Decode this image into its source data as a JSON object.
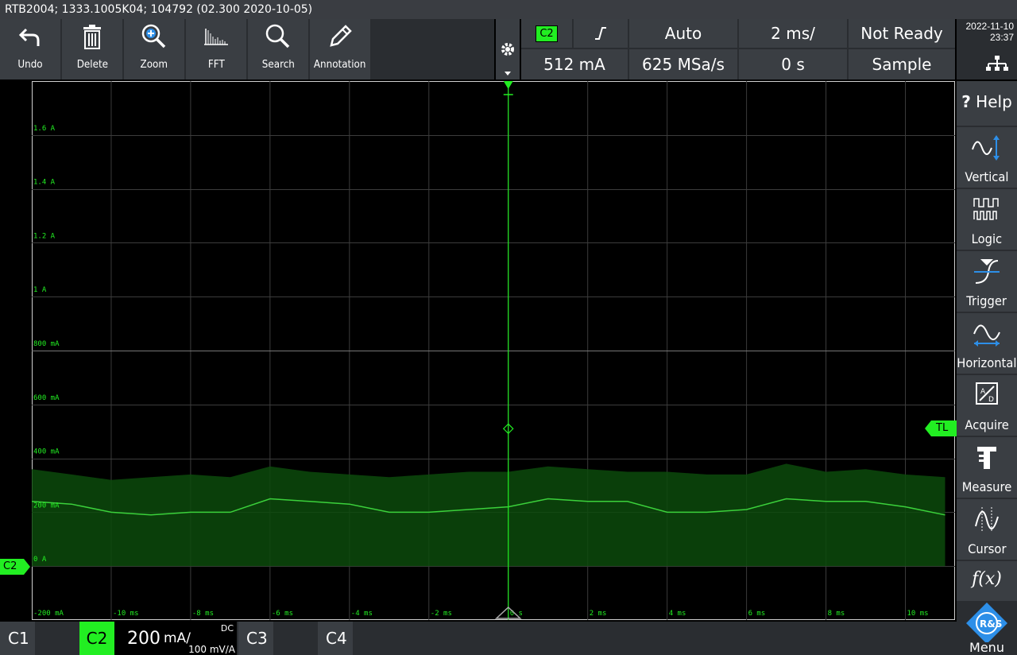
{
  "title": "RTB2004; 1333.1005K04; 104792 (02.300 2020-10-05)",
  "toolbar": {
    "items": [
      {
        "label": "Undo",
        "icon": "undo-icon"
      },
      {
        "label": "Delete",
        "icon": "trash-icon"
      },
      {
        "label": "Zoom",
        "icon": "zoom-icon"
      },
      {
        "label": "FFT",
        "icon": "fft-icon"
      },
      {
        "label": "Search",
        "icon": "search-icon"
      },
      {
        "label": "Annotation",
        "icon": "pencil-icon"
      }
    ]
  },
  "info": {
    "channel_badge": "C2",
    "trigger_level": "512 mA",
    "mode": "Auto",
    "sample_rate": "625 MSa/s",
    "timebase": "2 ms/",
    "time_offset": "0 s",
    "status": "Not Ready",
    "acquisition": "Sample"
  },
  "clock": {
    "date": "2022-11-10",
    "time": "23:37"
  },
  "sidebar": {
    "help": "Help",
    "items": [
      "Vertical",
      "Logic",
      "Trigger",
      "Horizontal",
      "Acquire",
      "Measure",
      "Cursor"
    ],
    "func_label": "f(x)",
    "menu": "Menu",
    "logo_text": "R&S"
  },
  "markers": {
    "channel": "C2",
    "trigger_level_tag": "TL"
  },
  "channels": {
    "c1": "C1",
    "c2": "C2",
    "c2_scale": "200",
    "c2_unit": "mA/",
    "c2_coupling": "DC",
    "c2_probe": "100 mV/A",
    "c3": "C3",
    "c4": "C4"
  },
  "colors": {
    "accent_green": "#22ee22",
    "trace_green": "#3bd13b",
    "panel": "#3a3e43",
    "bg": "#2a2d31"
  },
  "chart_data": {
    "type": "line",
    "xlabel": "",
    "ylabel": "",
    "y_tick_labels": [
      "1.6 A",
      "1.4 A",
      "1.2 A",
      "1 A",
      "800 mA",
      "600 mA",
      "400 mA",
      "200 mA",
      "0 A",
      "-200 mA"
    ],
    "x_tick_labels": [
      "-10 ms",
      "-8 ms",
      "-6 ms",
      "-4 ms",
      "-2 ms",
      "0 s",
      "2 ms",
      "4 ms",
      "6 ms",
      "8 ms",
      "10 ms"
    ],
    "xlim": [
      -12,
      11.25
    ],
    "ylim": [
      -0.2,
      1.8
    ],
    "grid": true,
    "series": [
      {
        "x": [
          -12,
          -11,
          -10,
          -9,
          -8,
          -7,
          -6,
          -5,
          -4,
          -3,
          -2,
          -1,
          0,
          1,
          2,
          3,
          4,
          5,
          6,
          7,
          8,
          9,
          10,
          11
        ],
        "values": [
          0.24,
          0.23,
          0.2,
          0.19,
          0.2,
          0.2,
          0.25,
          0.24,
          0.23,
          0.2,
          0.2,
          0.21,
          0.22,
          0.25,
          0.24,
          0.24,
          0.2,
          0.2,
          0.21,
          0.25,
          0.24,
          0.24,
          0.22,
          0.19
        ]
      }
    ],
    "envelope_high": [
      0.36,
      0.34,
      0.32,
      0.33,
      0.34,
      0.33,
      0.37,
      0.35,
      0.34,
      0.33,
      0.34,
      0.35,
      0.35,
      0.37,
      0.36,
      0.35,
      0.35,
      0.34,
      0.34,
      0.38,
      0.35,
      0.36,
      0.34,
      0.33
    ],
    "envelope_low": [
      0.0,
      0.0,
      0.0,
      0.0,
      0.0,
      0.0,
      0.0,
      0.0,
      0.0,
      0.0,
      0.0,
      0.0,
      0.0,
      0.0,
      0.0,
      0.0,
      0.0,
      0.0,
      0.0,
      0.0,
      0.0,
      0.0,
      0.0,
      0.0
    ]
  }
}
